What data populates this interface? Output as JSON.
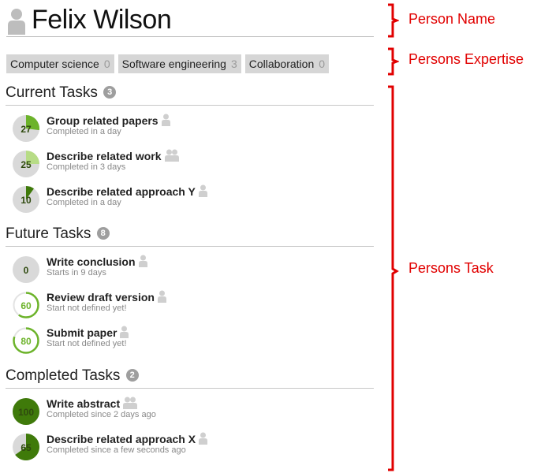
{
  "person": {
    "name": "Felix Wilson"
  },
  "expertise": [
    {
      "label": "Computer science",
      "count": "0"
    },
    {
      "label": "Software engineering",
      "count": "3"
    },
    {
      "label": "Collaboration",
      "count": "0"
    }
  ],
  "sections": {
    "current": {
      "title": "Current Tasks",
      "badge": "3"
    },
    "future": {
      "title": "Future Tasks",
      "badge": "8"
    },
    "completed": {
      "title": "Completed Tasks",
      "badge": "2"
    }
  },
  "tasks": {
    "current": [
      {
        "name": "Group related papers",
        "sub": "Completed in a day",
        "progress": 27,
        "people": 1
      },
      {
        "name": "Describe related work",
        "sub": "Completed in 3 days",
        "progress": 25,
        "people": 2
      },
      {
        "name": "Describe related approach Y",
        "sub": "Completed in a day",
        "progress": 10,
        "people": 1
      }
    ],
    "future": [
      {
        "name": "Write conclusion",
        "sub": "Starts in 9 days",
        "progress": 0,
        "people": 1
      },
      {
        "name": "Review draft version",
        "sub": "Start not defined yet!",
        "progress": 60,
        "people": 1
      },
      {
        "name": "Submit paper",
        "sub": "Start not defined yet!",
        "progress": 80,
        "people": 1
      }
    ],
    "completed": [
      {
        "name": "Write abstract",
        "sub": "Completed since 2 days ago",
        "progress": 100,
        "people": 2
      },
      {
        "name": "Describe related approach X",
        "sub": "Completed since a few seconds ago",
        "progress": 65,
        "people": 1
      }
    ]
  },
  "annotations": {
    "person_name": "Person Name",
    "expertise": "Persons Expertise",
    "task": "Persons Task"
  },
  "colors": {
    "green_dark": "#3f7a0a",
    "green_mid": "#6cb32a",
    "green_light": "#b7dc86",
    "track": "#d9d9d9",
    "annotation_red": "#e10000"
  }
}
